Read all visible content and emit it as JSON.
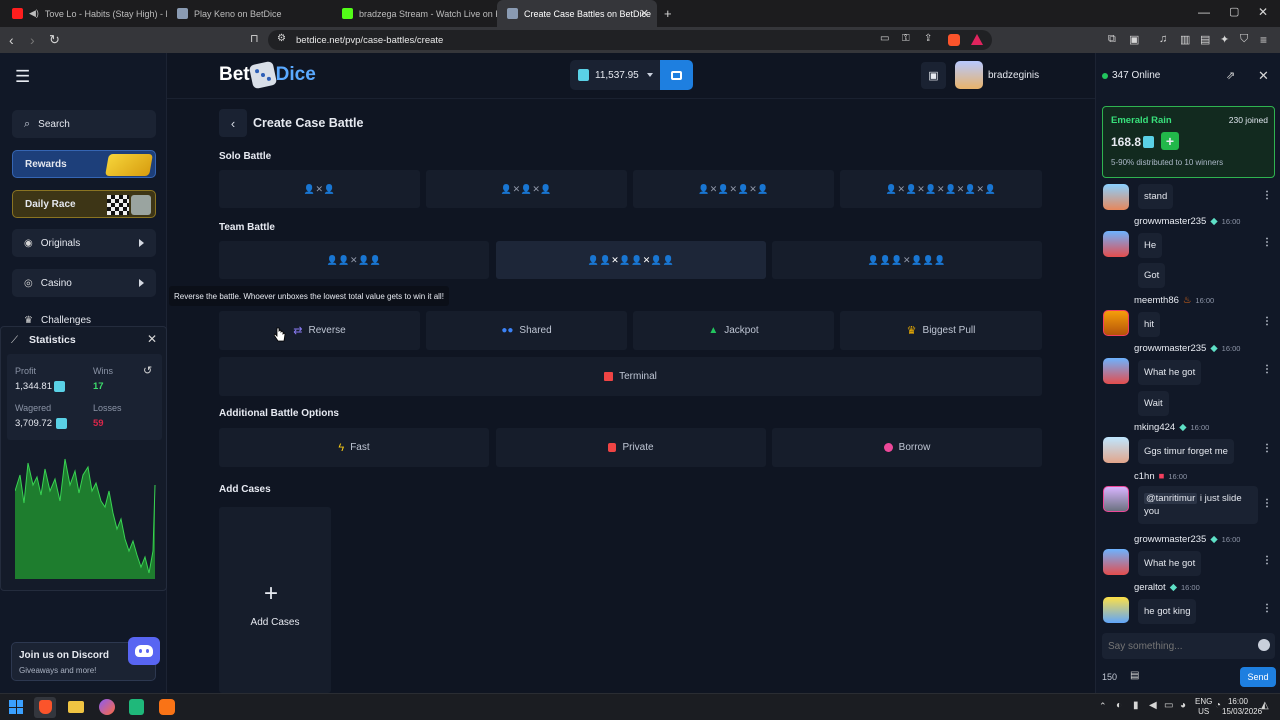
{
  "browser": {
    "tabs": [
      {
        "title": "Tove Lo - Habits (Stay High) - Hip",
        "favicon_color": "#ff1e1e"
      },
      {
        "title": "Play Keno on BetDice",
        "favicon_color": "#8a9bb3"
      },
      {
        "title": "bradzega Stream - Watch Live on Kic",
        "favicon_color": "#53fc18"
      },
      {
        "title": "Create Case Battles on BetDice",
        "favicon_color": "#8a9bb3"
      }
    ],
    "url": "betdice.net/pvp/case-battles/create"
  },
  "site": {
    "logo_bet": "Bet",
    "logo_dice": "Dice",
    "balance": "11,537.95",
    "username": "bradzeginis"
  },
  "sidebar": {
    "search_label": "Search",
    "rewards_label": "Rewards",
    "daily_race_label": "Daily Race",
    "originals_label": "Originals",
    "casino_label": "Casino",
    "challenges_label": "Challenges",
    "discord_title": "Join us on Discord",
    "discord_sub": "Giveaways and more!"
  },
  "statistics": {
    "title": "Statistics",
    "profit_label": "Profit",
    "profit_value": "1,344.81",
    "wins_label": "Wins",
    "wins_value": "17",
    "wagered_label": "Wagered",
    "wagered_value": "3,709.72",
    "losses_label": "Losses",
    "losses_value": "59",
    "chart_fill": "#1e7d2e",
    "chart_line": "#39d353"
  },
  "page": {
    "title": "Create Case Battle",
    "solo_title": "Solo Battle",
    "solo_options": [
      "👤✕👤",
      "👤✕👤✕👤",
      "👤✕👤✕👤✕👤",
      "👤✕👤✕👤✕👤✕👤✕👤"
    ],
    "team_title": "Team Battle",
    "team_options": [
      "👤👤✕👤👤",
      "👤👤✕👤👤✕👤👤",
      "👤👤👤✕👤👤👤"
    ],
    "tooltip": "Reverse the battle. Whoever unboxes the lowest total value gets to win it all!",
    "modes": [
      {
        "label": "Reverse",
        "icon": "reverse-icon",
        "color": "#8b7cf6"
      },
      {
        "label": "Shared",
        "icon": "users-icon",
        "color": "#3b82f6"
      },
      {
        "label": "Jackpot",
        "icon": "jackpot-icon",
        "color": "#22c55e"
      },
      {
        "label": "Biggest Pull",
        "icon": "crown-icon",
        "color": "#f5b301"
      }
    ],
    "terminal_label": "Terminal",
    "additional_title": "Additional Battle Options",
    "options": [
      {
        "label": "Fast",
        "icon": "bolt-icon",
        "color": "#facc15"
      },
      {
        "label": "Private",
        "icon": "lock-icon",
        "color": "#ef4444"
      },
      {
        "label": "Borrow",
        "icon": "moneybag-icon",
        "color": "#ec4899"
      }
    ],
    "add_cases_title": "Add Cases",
    "add_cases_label": "Add Cases"
  },
  "chat": {
    "online": "347 Online",
    "rain_title": "Emerald Rain",
    "rain_joined": "230 joined",
    "rain_amount": "168.8",
    "rain_sub": "5-90% distributed to 10 winners",
    "messages": [
      {
        "text": "stand"
      },
      {
        "user": "growwmaster235",
        "time": "16:00",
        "text": "He"
      },
      {
        "text": "Got"
      },
      {
        "user": "meemth86",
        "time": "16:00",
        "text": "hit"
      },
      {
        "user": "growwmaster235",
        "time": "16:00",
        "text": "What he got"
      },
      {
        "text": "Wait"
      },
      {
        "user": "mking424",
        "time": "16:00",
        "text": "Ggs timur forget me"
      },
      {
        "user": "c1hn",
        "time": "16:00",
        "mention": "@tanritimur",
        "text": " i just slide you"
      },
      {
        "user": "growwmaster235",
        "time": "16:00",
        "text": "What he got"
      },
      {
        "user": "geraltot",
        "time": "16:00",
        "text": "he got king"
      }
    ],
    "input_placeholder": "Say something...",
    "char_count": "150",
    "send_label": "Send"
  },
  "taskbar": {
    "lang1": "ENG",
    "lang2": "US",
    "time": "16:00",
    "date": "15/03/2026"
  }
}
